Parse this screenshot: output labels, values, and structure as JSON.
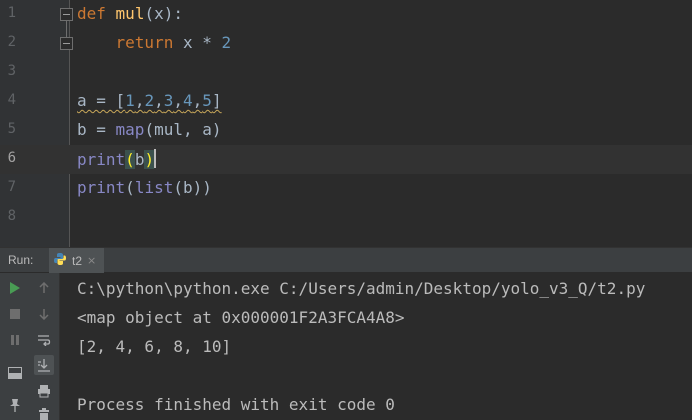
{
  "editor": {
    "line_numbers": [
      "1",
      "2",
      "3",
      "4",
      "5",
      "6",
      "7",
      "8"
    ],
    "line1": {
      "kw": "def",
      "name": "mul",
      "rest": "(x):"
    },
    "line2": {
      "indent": "    ",
      "kw": "return",
      "rest": " x * ",
      "num": "2"
    },
    "line4": {
      "pre": "a = [",
      "n1": "1",
      "n2": "2",
      "n3": "3",
      "n4": "4",
      "n5": "5",
      "sep": ",",
      "post": "]"
    },
    "line5": {
      "pre": "b = ",
      "fn": "map",
      "rest": "(mul, a)"
    },
    "line6": {
      "fn": "print",
      "open": "(",
      "arg": "b",
      "close": ")"
    },
    "line7": {
      "fn": "print",
      "open": "(",
      "fn2": "list",
      "rest": "(b))"
    }
  },
  "run_window": {
    "label": "Run:",
    "tab_label": "t2",
    "tab_close": "×"
  },
  "console": {
    "lines": [
      "C:\\python\\python.exe C:/Users/admin/Desktop/yolo_v3_Q/t2.py",
      "<map object at 0x000001F2A3FCA4A8>",
      "[2, 4, 6, 8, 10]",
      "",
      "Process finished with exit code 0"
    ]
  },
  "icons": {
    "run": "play-icon",
    "up": "arrow-up-icon",
    "stop": "stop-icon",
    "down": "arrow-down-icon",
    "pause": "pause-icon",
    "soft_wrap": "soft-wrap-icon",
    "scroll_end": "scroll-to-end-icon",
    "layout": "restore-layout-icon",
    "print": "print-icon",
    "pin": "pin-icon",
    "trash": "trash-icon",
    "python_file": "python-file-icon"
  },
  "colors": {
    "keyword": "#cc7832",
    "function_name": "#ffc66d",
    "number": "#6897bb",
    "builtin": "#8888c6",
    "default_text": "#a9b7c6",
    "run_green": "#499c54"
  }
}
